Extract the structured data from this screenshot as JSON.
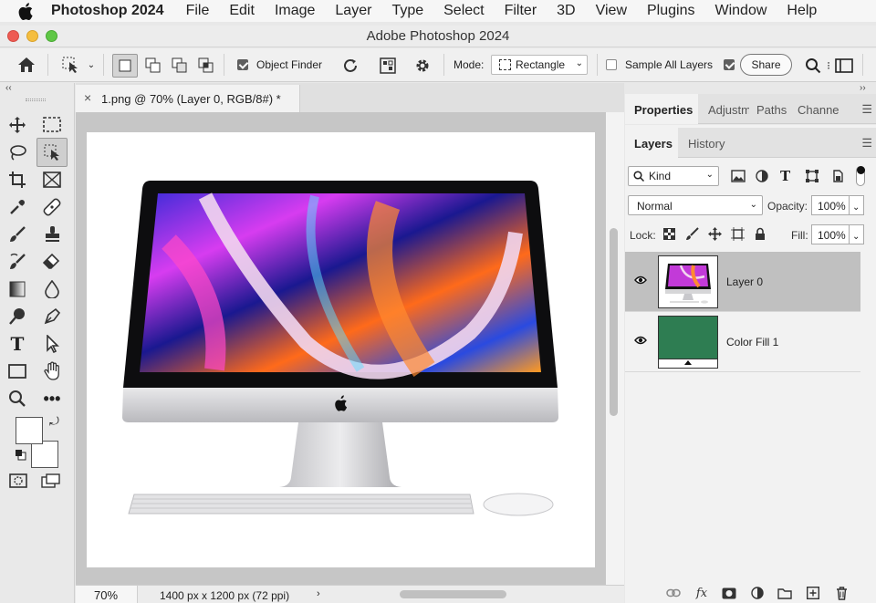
{
  "menubar": {
    "app_name": "Photoshop 2024",
    "items": [
      "File",
      "Edit",
      "Image",
      "Layer",
      "Type",
      "Select",
      "Filter",
      "3D",
      "View",
      "Plugins",
      "Window",
      "Help"
    ]
  },
  "window": {
    "title": "Adobe Photoshop 2024"
  },
  "options": {
    "object_finder_label": "Object Finder",
    "object_finder_checked": true,
    "mode_label": "Mode:",
    "mode_value": "Rectangle",
    "sample_all_layers_label": "Sample All Layers",
    "sample_all_layers_checked": false,
    "share_label": "Share"
  },
  "document": {
    "tab_title": "1.png @ 70% (Layer 0, RGB/8#) *",
    "zoom": "70%",
    "info": "1400 px x 1200 px (72 ppi)"
  },
  "panels": {
    "top_tabs": [
      "Properties",
      "Adjustm",
      "Paths",
      "Channe"
    ],
    "layer_tabs": [
      "Layers",
      "History"
    ],
    "kind_label": "Kind",
    "blend_mode": "Normal",
    "opacity_label": "Opacity:",
    "opacity_value": "100%",
    "lock_label": "Lock:",
    "fill_label": "Fill:",
    "fill_value": "100%",
    "layers": [
      {
        "name": "Layer 0",
        "selected": true
      },
      {
        "name": "Color Fill 1",
        "selected": false,
        "color": "#2e7d52"
      }
    ]
  },
  "colors": {
    "accent_fill": "#2e7d52"
  }
}
